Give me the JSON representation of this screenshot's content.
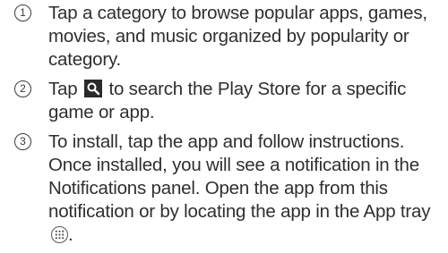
{
  "steps": [
    {
      "number": "1",
      "text": "Tap a category to browse popular apps, games, movies, and music organized by popularity or category."
    },
    {
      "number": "2",
      "text_before": "Tap",
      "icon": "search-icon",
      "text_after": "to search the Play Store for a specific game or app."
    },
    {
      "number": "3",
      "text_before": "To install, tap the app and follow instructions. Once installed, you will see a notification in the Notifications panel. Open the app from this notification or by locating the app in the App tray",
      "icon": "app-tray-icon",
      "text_after": "."
    }
  ],
  "colors": {
    "text": "#2f2f2f",
    "search_icon_bg": "#2a2a2a"
  }
}
